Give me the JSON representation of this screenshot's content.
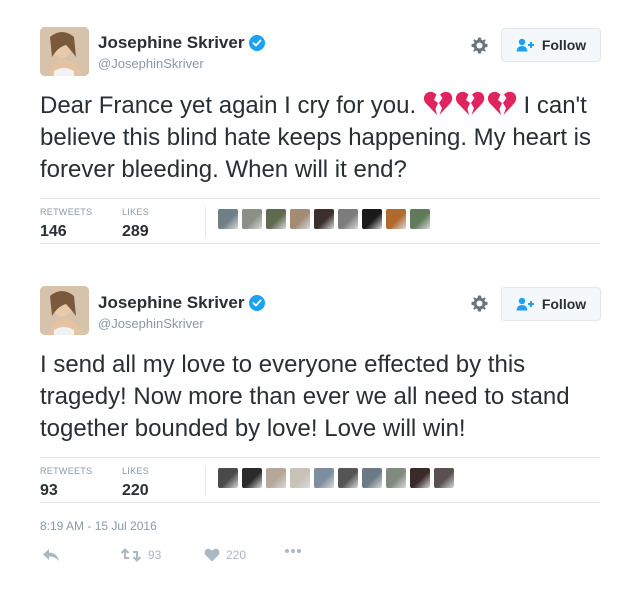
{
  "colors": {
    "text": "#292f33",
    "secondary": "#8899a6",
    "border": "#e1e8ed",
    "verified": "#1da1f2",
    "broken_heart": "#e0245e",
    "action_gray": "#aab8c2"
  },
  "tweets": [
    {
      "user": {
        "display_name": "Josephine Skriver",
        "handle": "@JosephinSkriver",
        "verified": true
      },
      "follow_label": "Follow",
      "text_before_emoji": "Dear France yet again I cry for you.",
      "emoji": [
        "broken-heart-icon",
        "broken-heart-icon",
        "broken-heart-icon"
      ],
      "text_after_emoji": " I can't believe this blind hate keeps happening. My heart is forever bleeding. When will it end?",
      "stats": {
        "retweets_label": "RETWEETS",
        "retweets": "146",
        "likes_label": "LIKES",
        "likes": "289"
      },
      "liker_avatars": [
        "#6f7f88",
        "#8a8f87",
        "#5f6a4f",
        "#a38b74",
        "#3a2f2c",
        "#7c7c7c",
        "#1a1a1a",
        "#b06a2e",
        "#607a5a"
      ]
    },
    {
      "user": {
        "display_name": "Josephine Skriver",
        "handle": "@JosephinSkriver",
        "verified": true
      },
      "follow_label": "Follow",
      "text": "I send all my love to everyone effected by this tragedy! Now more than ever we all need to stand together bounded by love! Love will win!",
      "stats": {
        "retweets_label": "RETWEETS",
        "retweets": "93",
        "likes_label": "LIKES",
        "likes": "220"
      },
      "liker_avatars": [
        "#4a4a4a",
        "#2a2a2a",
        "#b7a79a",
        "#c9c2b8",
        "#7c8ea0",
        "#555555",
        "#6b7a86",
        "#808a7e",
        "#3b2a2a",
        "#5a5050"
      ],
      "timestamp": "8:19 AM - 15 Jul 2016",
      "actions": {
        "retweet_count": "93",
        "like_count": "220"
      }
    }
  ]
}
